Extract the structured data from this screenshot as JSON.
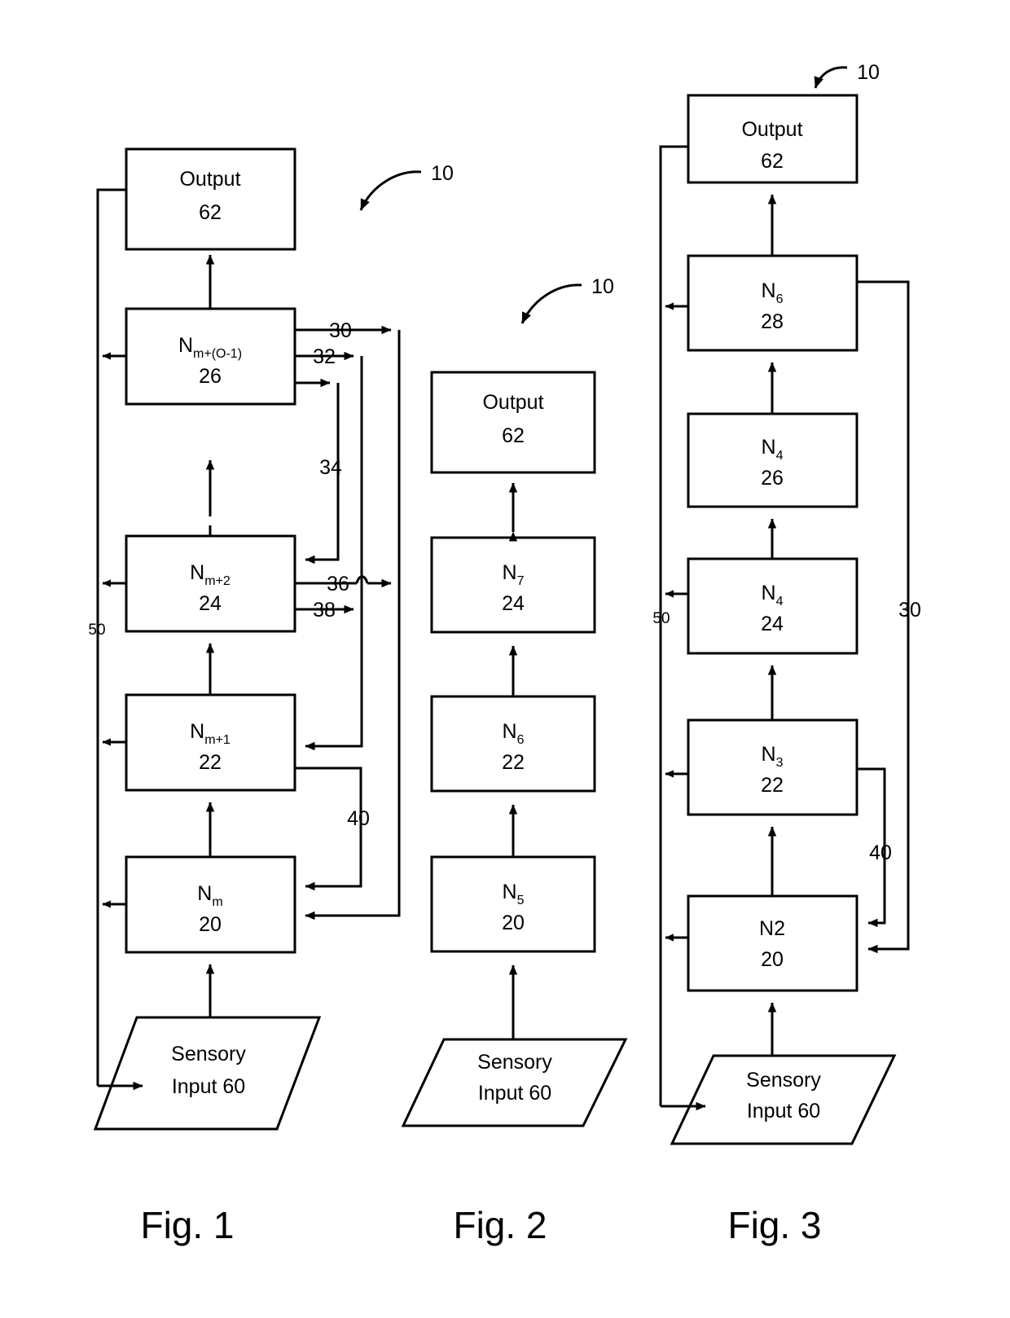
{
  "figures": [
    {
      "caption": "Fig. 1",
      "system_ref": "10",
      "feedback_label": "50",
      "output": {
        "line1": "Output",
        "line2": "62"
      },
      "input": {
        "line1": "Sensory",
        "line2": "Input 60"
      },
      "nodes": [
        {
          "name": "N",
          "sub": "m+(O-1)",
          "ref": "26"
        },
        {
          "name": "N",
          "sub": "m+2",
          "ref": "24"
        },
        {
          "name": "N",
          "sub": "m+1",
          "ref": "22"
        },
        {
          "name": "N",
          "sub": "m",
          "ref": "20"
        }
      ],
      "connector_labels": [
        "30",
        "32",
        "34",
        "36",
        "38",
        "40"
      ]
    },
    {
      "caption": "Fig. 2",
      "system_ref": "10",
      "output": {
        "line1": "Output",
        "line2": "62"
      },
      "input": {
        "line1": "Sensory",
        "line2": "Input 60"
      },
      "nodes": [
        {
          "name": "N",
          "sub": "7",
          "ref": "24"
        },
        {
          "name": "N",
          "sub": "6",
          "ref": "22"
        },
        {
          "name": "N",
          "sub": "5",
          "ref": "20"
        }
      ],
      "connector_labels": []
    },
    {
      "caption": "Fig. 3",
      "system_ref": "10",
      "feedback_label": "50",
      "output": {
        "line1": "Output",
        "line2": "62"
      },
      "input": {
        "line1": "Sensory",
        "line2": "Input 60"
      },
      "nodes": [
        {
          "name": "N",
          "sub": "6",
          "ref": "28"
        },
        {
          "name": "N",
          "sub": "4",
          "ref": "26"
        },
        {
          "name": "N",
          "sub": "4",
          "ref": "24"
        },
        {
          "name": "N",
          "sub": "3",
          "ref": "22"
        },
        {
          "name": "N2",
          "sub": "",
          "ref": "20"
        }
      ],
      "connector_labels": [
        "30",
        "40"
      ]
    }
  ]
}
